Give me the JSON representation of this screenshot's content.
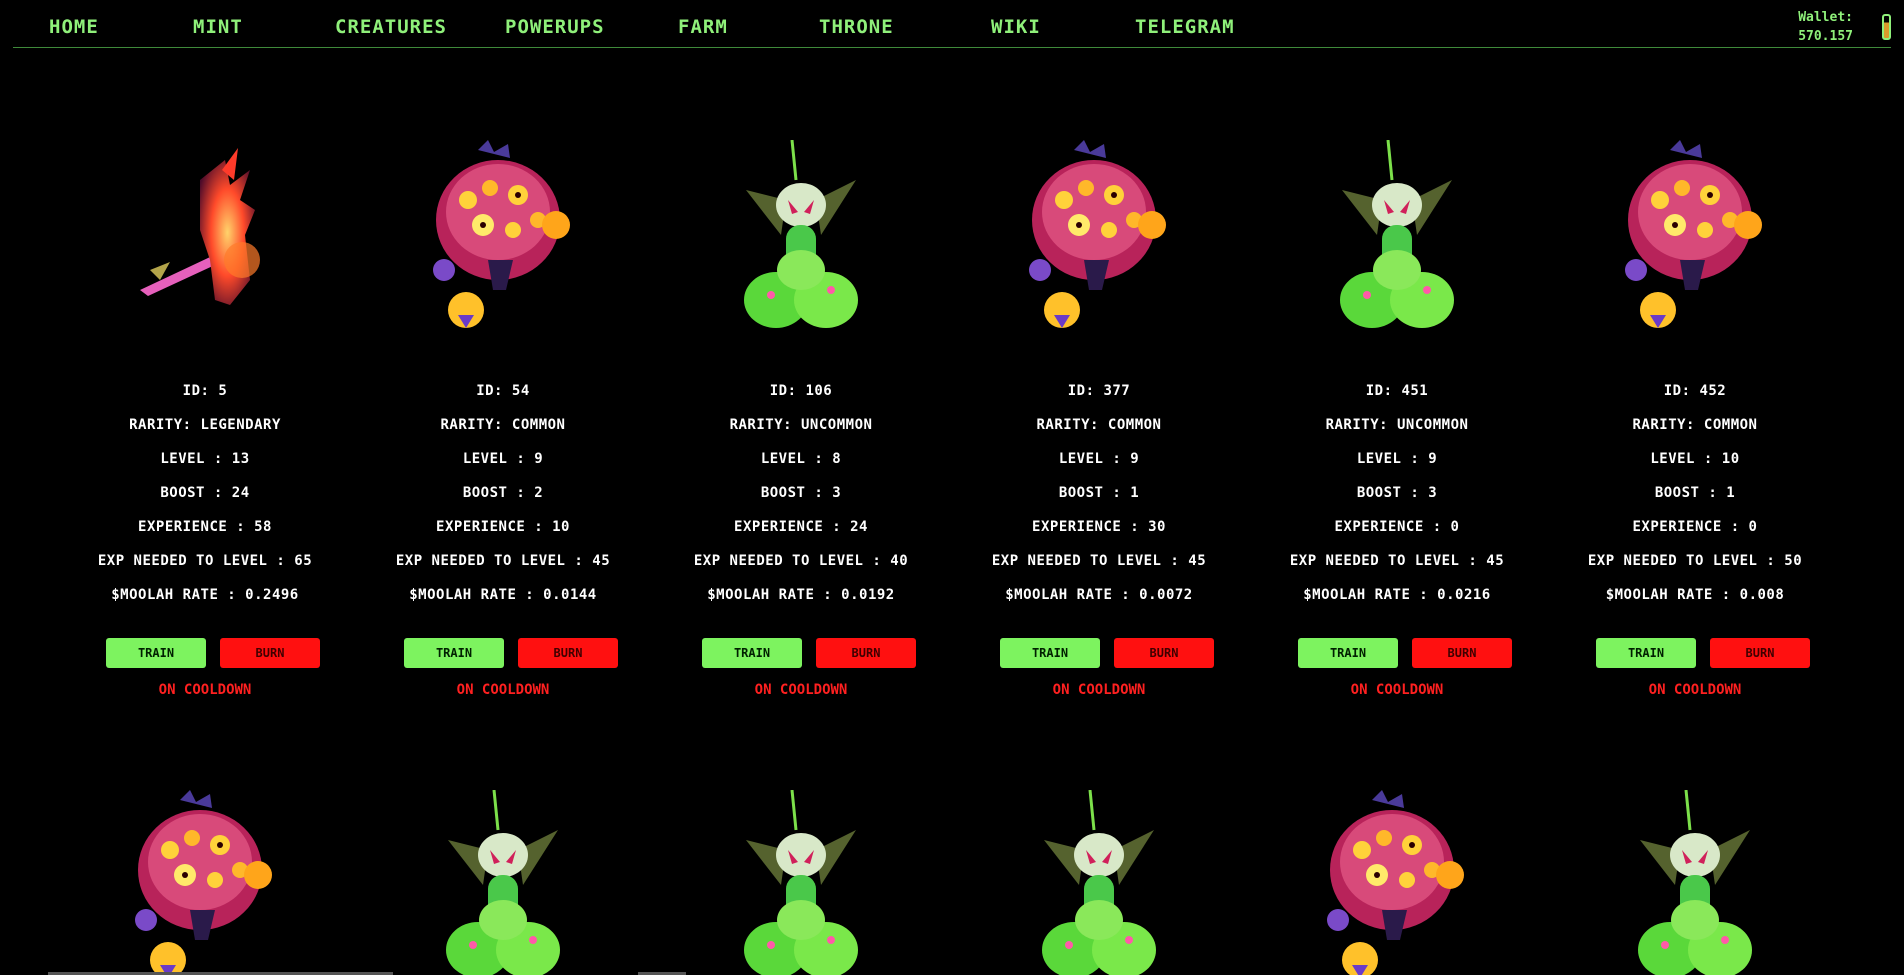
{
  "nav": {
    "items": [
      "Home",
      "Mint",
      "Creatures",
      "Powerups",
      "Farm",
      "Throne",
      "Wiki",
      "Telegram"
    ],
    "wallet_label": "Wallet:",
    "wallet_value": "570.157"
  },
  "labels": {
    "train": "Train",
    "burn": "Burn",
    "cooldown": "On Cooldown"
  },
  "cards": [
    {
      "id": "ID: 5",
      "rarity": "Rarity: Legendary",
      "level": "Level : 13",
      "boost": "Boost : 24",
      "experience": "Experience : 58",
      "exp_needed": "Exp Needed To Level : 65",
      "rate": "$Moolah Rate : 0.2496",
      "creature": "flame-knight"
    },
    {
      "id": "ID: 54",
      "rarity": "Rarity: Common",
      "level": "Level : 9",
      "boost": "Boost : 2",
      "experience": "Experience : 10",
      "exp_needed": "Exp Needed To Level : 45",
      "rate": "$Moolah Rate : 0.0144",
      "creature": "eye-blob"
    },
    {
      "id": "ID: 106",
      "rarity": "Rarity: Uncommon",
      "level": "Level : 8",
      "boost": "Boost : 3",
      "experience": "Experience : 24",
      "exp_needed": "Exp Needed To Level : 40",
      "rate": "$Moolah Rate : 0.0192",
      "creature": "green-bug"
    },
    {
      "id": "ID: 377",
      "rarity": "Rarity: Common",
      "level": "Level : 9",
      "boost": "Boost : 1",
      "experience": "Experience : 30",
      "exp_needed": "Exp Needed To Level : 45",
      "rate": "$Moolah Rate : 0.0072",
      "creature": "eye-blob"
    },
    {
      "id": "ID: 451",
      "rarity": "Rarity: Uncommon",
      "level": "Level : 9",
      "boost": "Boost : 3",
      "experience": "Experience : 0",
      "exp_needed": "Exp Needed To Level : 45",
      "rate": "$Moolah Rate : 0.0216",
      "creature": "green-bug"
    },
    {
      "id": "ID: 452",
      "rarity": "Rarity: Common",
      "level": "Level : 10",
      "boost": "Boost : 1",
      "experience": "Experience : 0",
      "exp_needed": "Exp Needed To Level : 50",
      "rate": "$Moolah Rate : 0.008",
      "creature": "eye-blob"
    }
  ],
  "next_row": [
    "eye-blob",
    "green-bug",
    "green-bug",
    "green-bug",
    "eye-blob",
    "green-bug"
  ],
  "colors": {
    "nav_text": "#8ff07a",
    "train": "#7df35f",
    "burn": "#ff1010",
    "cooldown": "#ff2020"
  }
}
